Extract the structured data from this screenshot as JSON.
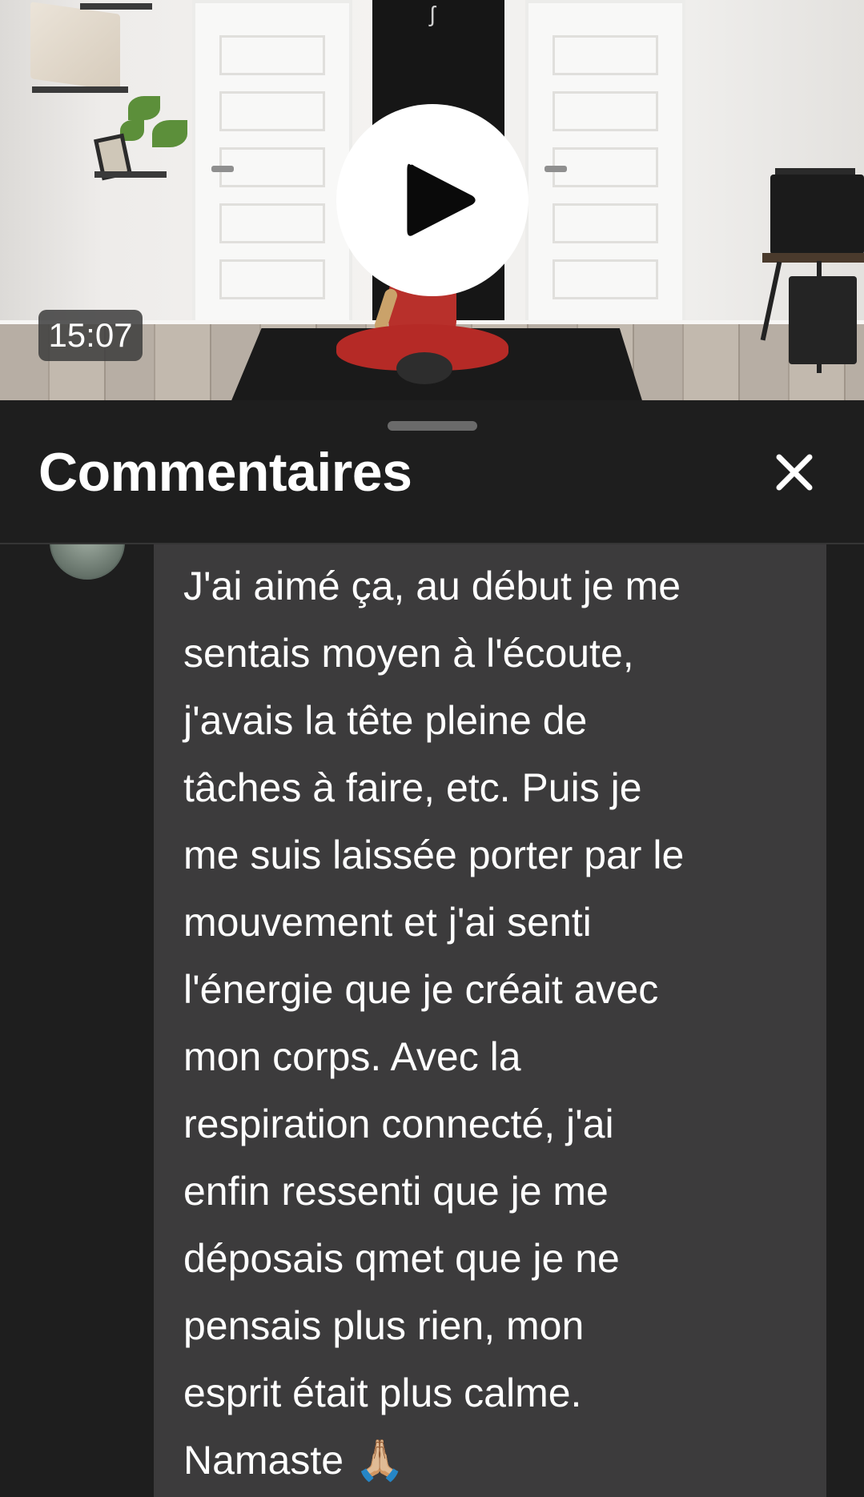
{
  "video": {
    "duration": "15:07",
    "play_icon": "play-icon",
    "banner_mark": "ʃ"
  },
  "comments_panel": {
    "title": "Commentaires",
    "close_icon": "close-icon",
    "comment": {
      "text": "J'ai aimé ça, au début je me\nsentais moyen à l'écoute,\nj'avais la tête pleine de\ntâches à faire, etc. Puis je\nme suis laissée porter par le\nmouvement et j'ai senti\nl'énergie que je créait avec\nmon corps. Avec la\nrespiration connecté, j'ai\nenfin ressenti que je me\ndéposais qmet que je ne\npensais plus rien, mon\nesprit était plus calme.\nNamaste 🙏🏼"
    }
  },
  "colors": {
    "background": "#1e1e1e",
    "comment_bubble": "#3c3b3c",
    "text": "#ffffff",
    "duration_badge": "#3c3c3c"
  }
}
